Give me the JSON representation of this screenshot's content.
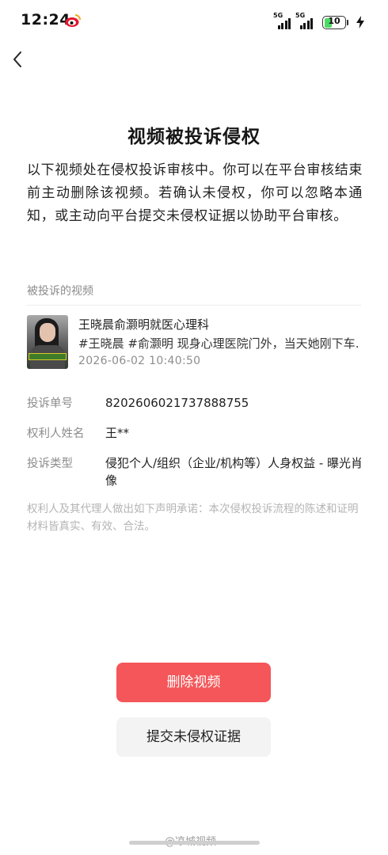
{
  "status_bar": {
    "time": "12:24",
    "signal_1_label": "5G",
    "signal_2_label": "5G",
    "battery_level": "10",
    "colors": {
      "battery_fill": "#4cd964"
    }
  },
  "nav": {
    "back_icon": "chevron-left-icon"
  },
  "page": {
    "title": "视频被投诉侵权",
    "notice": "以下视频处在侵权投诉审核中。你可以在平台审核结束前主动删除该视频。若确认未侵权，你可以忽略本通知，或主动向平台提交未侵权证据以协助平台审核。"
  },
  "complaint": {
    "section_label": "被投诉的视频",
    "video": {
      "title": "王晓晨俞灏明就医心理科",
      "description": "#王晓晨 #俞灏明 现身心理医院门外，当天她刚下车…",
      "timestamp": "2026-06-02 10:40:50"
    },
    "fields": [
      {
        "label": "投诉单号",
        "value": "8202606021737888755"
      },
      {
        "label": "权利人姓名",
        "value": "王**"
      },
      {
        "label": "投诉类型",
        "value": "侵犯个人/组织（企业/机构等）人身权益 - 曝光肖像"
      }
    ],
    "declaration": "权利人及其代理人做出如下声明承诺：本次侵权投诉流程的陈述和证明材料皆真实、有效、合法。"
  },
  "actions": {
    "delete_label": "删除视频",
    "submit_label": "提交未侵权证据",
    "colors": {
      "delete_bg": "#f45659",
      "submit_bg": "#f3f3f3"
    }
  },
  "watermark": {
    "text": "@凉城视频"
  }
}
